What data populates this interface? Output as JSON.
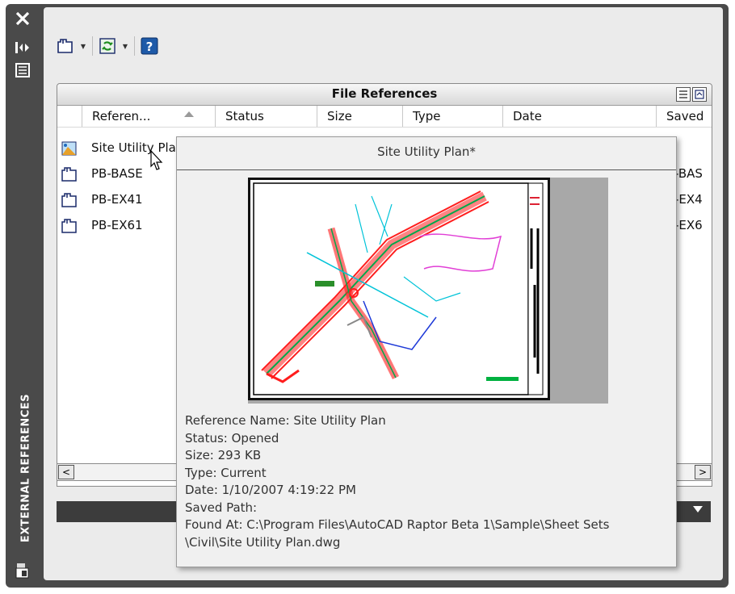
{
  "palette": {
    "sidebar": "#4a4a4a",
    "panel": "#ebebeb",
    "highlight_bar": "#3c3c3c"
  },
  "sidebar": {
    "title": "EXTERNAL REFERENCES",
    "icons": [
      "close-icon",
      "auto-hide-icon",
      "properties-icon",
      "xref-manager-icon"
    ]
  },
  "toolbar": {
    "icons": [
      "attach-dwg-icon",
      "refresh-icon",
      "help-icon"
    ]
  },
  "file_references": {
    "title": "File References",
    "columns": [
      "Referen...",
      "Status",
      "Size",
      "Type",
      "Date",
      "Saved"
    ],
    "rows": [
      {
        "name": "Site Utility Pla",
        "icon": "current-drawing-icon",
        "saved": ""
      },
      {
        "name": "PB-BASE",
        "icon": "dwg-file-icon",
        "saved": "-BAS"
      },
      {
        "name": "PB-EX41",
        "icon": "dwg-file-icon",
        "saved": "-EX4"
      },
      {
        "name": "PB-EX61",
        "icon": "dwg-file-icon",
        "saved": "-EX6"
      }
    ]
  },
  "scroll": {
    "left": "<",
    "right": ">"
  },
  "tooltip": {
    "title": "Site Utility Plan*",
    "preview_icon": "drawing-preview-image",
    "lines": [
      "Reference Name: Site Utility Plan",
      "Status: Opened",
      "Size: 293 KB",
      "Type: Current",
      "Date: 1/10/2007 4:19:22 PM",
      "Saved Path:",
      "Found At: C:\\Program Files\\AutoCAD Raptor Beta 1\\Sample\\Sheet Sets",
      "\\Civil\\Site Utility Plan.dwg"
    ]
  }
}
